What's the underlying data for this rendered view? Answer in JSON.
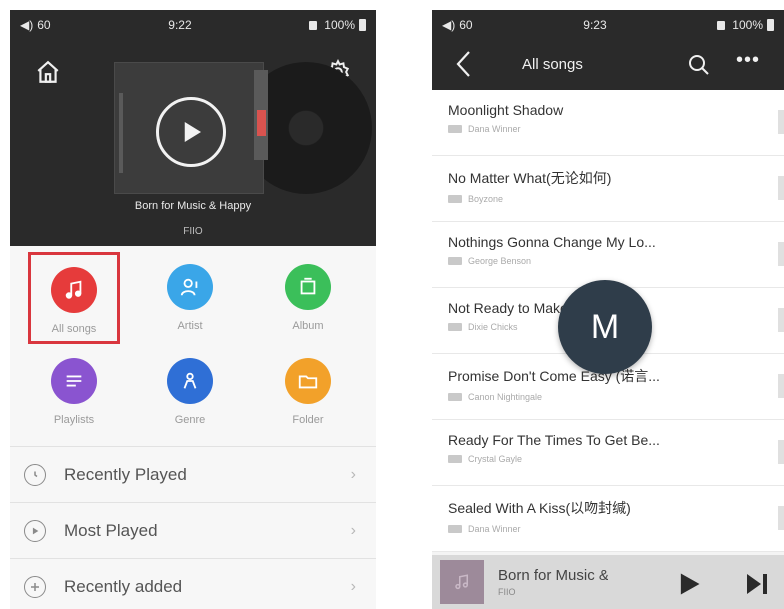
{
  "left": {
    "status": {
      "volume": "60",
      "time": "9:22",
      "battery": "100%"
    },
    "now_playing": {
      "title": "Born for Music & Happy",
      "format": "FIIO"
    },
    "categories": [
      {
        "label": "All songs",
        "color": "#e63b3b"
      },
      {
        "label": "Artist",
        "color": "#3aa6e8"
      },
      {
        "label": "Album",
        "color": "#3bbf5a"
      },
      {
        "label": "Playlists",
        "color": "#8a54d0"
      },
      {
        "label": "Genre",
        "color": "#2f6fd6"
      },
      {
        "label": "Folder",
        "color": "#f2a12a"
      }
    ],
    "rows": [
      {
        "label": "Recently Played"
      },
      {
        "label": "Most Played"
      },
      {
        "label": "Recently added"
      }
    ]
  },
  "right": {
    "status": {
      "volume": "60",
      "time": "9:23",
      "battery": "100%"
    },
    "header": {
      "title": "All songs"
    },
    "songs": [
      {
        "title": "Moonlight Shadow",
        "artist": "Dana Winner"
      },
      {
        "title": "No Matter What(无论如何)",
        "artist": "Boyzone"
      },
      {
        "title": "Nothings Gonna Change My Lo...",
        "artist": "George Benson"
      },
      {
        "title": "Not Ready to Make Nice",
        "artist": "Dixie Chicks"
      },
      {
        "title": "Promise Don't Come Easy (诺言...",
        "artist": "Canon Nightingale"
      },
      {
        "title": "Ready For The Times To Get Be...",
        "artist": "Crystal Gayle"
      },
      {
        "title": "Sealed With A Kiss(以吻封缄)",
        "artist": "Dana Winner"
      }
    ],
    "index_letter": "M",
    "mini_player": {
      "title": "Born for Music & Happy",
      "format": "FIIO"
    }
  },
  "colors": {
    "dark_bg": "#2a2a2a",
    "accent_red": "#d9363e"
  }
}
